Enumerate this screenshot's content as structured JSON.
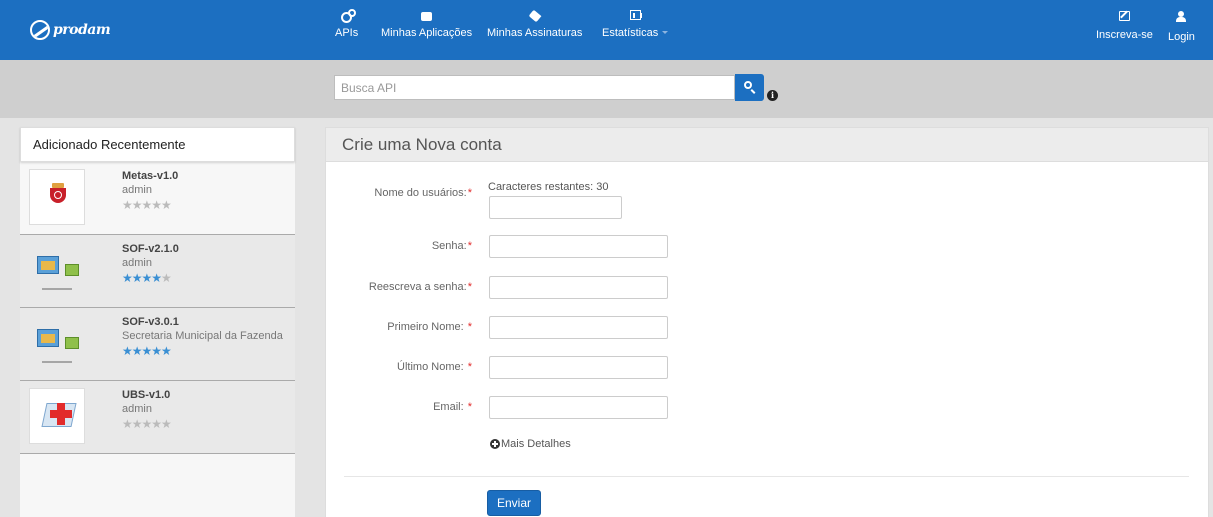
{
  "brand": {
    "name": "prodam"
  },
  "nav": {
    "items": [
      {
        "label": "APIs",
        "icon": "cogs-icon"
      },
      {
        "label": "Minhas Aplicações",
        "icon": "briefcase-icon"
      },
      {
        "label": "Minhas Assinaturas",
        "icon": "tag-icon"
      },
      {
        "label": "Estatísticas",
        "icon": "bar-chart-icon"
      }
    ],
    "right": [
      {
        "label": "Inscreva-se",
        "icon": "edit-icon"
      },
      {
        "label": "Login",
        "icon": "user-icon"
      }
    ]
  },
  "search": {
    "placeholder": "Busca API",
    "info_icon_text": "i"
  },
  "recent": {
    "title": "Adicionado Recentemente",
    "items": [
      {
        "name": "Metas-v1.0",
        "owner": "admin",
        "rating": 0,
        "thumb": "city-crest"
      },
      {
        "name": "SOF-v2.1.0",
        "owner": "admin",
        "rating": 4.5,
        "thumb": "sof-icon"
      },
      {
        "name": "SOF-v3.0.1",
        "owner": "Secretaria Municipal da Fazenda",
        "rating": 5,
        "thumb": "sof-icon"
      },
      {
        "name": "UBS-v1.0",
        "owner": "admin",
        "rating": 0,
        "thumb": "ubs-map"
      }
    ]
  },
  "form": {
    "title": "Crie uma Nova conta",
    "remaining_text": "Caracteres restantes: 30",
    "fields": [
      {
        "label": "Nome do usuários:",
        "required_mark": "*"
      },
      {
        "label": "Senha:",
        "required_mark": "*"
      },
      {
        "label": "Reescreva a senha:",
        "required_mark": "*"
      },
      {
        "label": "Primeiro Nome: ",
        "required_mark": "*"
      },
      {
        "label": "Último Nome: ",
        "required_mark": "*"
      },
      {
        "label": "Email: ",
        "required_mark": "*"
      }
    ],
    "more_details": "Mais Detalhes",
    "submit": "Enviar"
  },
  "colors": {
    "primary": "#1c6fc1",
    "search_strip": "#cfcfcf",
    "background": "#e4e4e4",
    "star_active": "#3a8fd3",
    "required": "#e22b2b"
  }
}
